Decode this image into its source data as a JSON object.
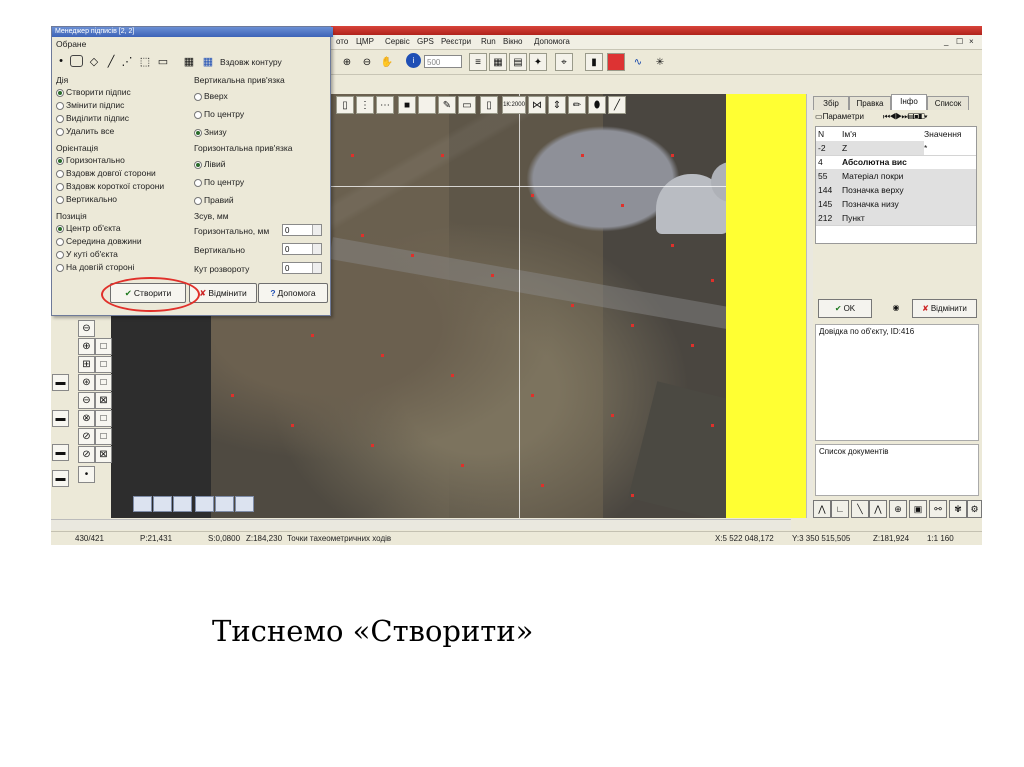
{
  "menu": {
    "items": [
      "ото",
      "ЦМР",
      "Сервіс",
      "GPS",
      "Реєстри",
      "Run",
      "Вікно",
      "Допомога"
    ],
    "window_controls": [
      "_",
      "☐",
      "×"
    ]
  },
  "toolbar": {
    "scale_value": "500",
    "scale_preset": "1К:2000"
  },
  "dialog": {
    "title": "Менеджер підписів  [2, 2]",
    "selected_group": "Обране",
    "contour_button": "Вздовж контуру",
    "action_group": "Дія",
    "actions": [
      {
        "label": "Створити підпис",
        "selected": true
      },
      {
        "label": "Змінити підпис",
        "selected": false
      },
      {
        "label": "Виділити підпис",
        "selected": false
      },
      {
        "label": "Удалить все",
        "selected": false
      }
    ],
    "vertical_binding_group": "Вертикальна прив'язка",
    "vertical_binding": [
      {
        "label": "Вверх",
        "selected": false
      },
      {
        "label": "По центру",
        "selected": false
      },
      {
        "label": "Знизу",
        "selected": true
      }
    ],
    "orientation_group": "Орієнтація",
    "orientation": [
      {
        "label": "Горизонтально",
        "selected": true
      },
      {
        "label": "Вздовж довгої сторони",
        "selected": false
      },
      {
        "label": "Вздовж короткої сторони",
        "selected": false
      },
      {
        "label": "Вертикально",
        "selected": false
      }
    ],
    "horizontal_binding_group": "Горизонтальна прив'язка",
    "horizontal_binding": [
      {
        "label": "Лівий",
        "selected": true
      },
      {
        "label": "По центру",
        "selected": false
      },
      {
        "label": "Правий",
        "selected": false
      }
    ],
    "position_group": "Позиція",
    "position": [
      {
        "label": "Центр об'єкта",
        "selected": true
      },
      {
        "label": "Середина довжини",
        "selected": false
      },
      {
        "label": "У куті об'єкта",
        "selected": false
      },
      {
        "label": "На довгій стороні",
        "selected": false
      }
    ],
    "offset_group": "Зсув, мм",
    "offset_horizontal_label": "Горизонтально, мм",
    "offset_horizontal_value": "0",
    "offset_vertical_label": "Вертикально",
    "offset_vertical_value": "0",
    "rotation_label": "Кут розвороту",
    "rotation_value": "0",
    "create_button": "Створити",
    "cancel_button": "Відмінити",
    "help_button": "Допомога"
  },
  "right_panel": {
    "tabs": [
      "Збір",
      "Правка",
      "Інфо",
      "Список"
    ],
    "active_tab": "Інфо",
    "params_label": "Параметри",
    "table_headers": [
      "N",
      "Ім'я",
      "Значення"
    ],
    "rows": [
      {
        "n": "-2",
        "name": "Z",
        "value": "*"
      },
      {
        "n": "4",
        "name": "Абсолютна вис",
        "value": ""
      },
      {
        "n": "55",
        "name": "Матеріал покри",
        "value": ""
      },
      {
        "n": "144",
        "name": "Позначка верху",
        "value": ""
      },
      {
        "n": "145",
        "name": "Позначка низу",
        "value": ""
      },
      {
        "n": "212",
        "name": "Пункт",
        "value": ""
      }
    ],
    "ok_button": "OK",
    "cancel_button": "Відмінити",
    "object_help": "Довідка по об'єкту, ID:416",
    "docs_list": "Список документів"
  },
  "status": {
    "counter": "430/421",
    "p": "P:21,431",
    "s": "S:0,0800",
    "z": "Z:184,230",
    "layer": "Точки тахеометричних ходів",
    "x": "X:5 522 048,172",
    "y": "Y:3 350 515,505",
    "z2": "Z:181,924",
    "scale": "1:1 160"
  },
  "caption": "Тиснемо «Створити»",
  "colors": {
    "accent_yellow": "#FFFF33",
    "highlight_red": "#E0302A"
  }
}
